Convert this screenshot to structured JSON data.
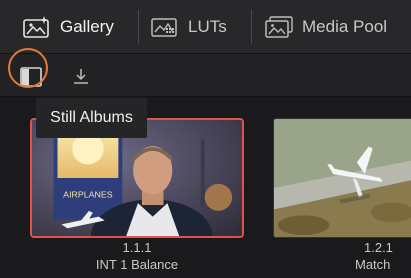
{
  "tabs": [
    {
      "label": "Gallery",
      "icon": "gallery-icon",
      "active": true
    },
    {
      "label": "LUTs",
      "icon": "luts-icon",
      "active": false
    },
    {
      "label": "Media Pool",
      "icon": "media-pool-icon",
      "active": false
    }
  ],
  "toolbar": {
    "still_albums_icon": "still-albums-icon",
    "import_icon": "import-icon",
    "tooltip": "Still Albums"
  },
  "stills": [
    {
      "number": "1.1.1",
      "name": "INT 1 Balance",
      "selected": true
    },
    {
      "number": "1.2.1",
      "name": "Match",
      "selected": false
    }
  ],
  "colors": {
    "highlight_ring": "#e47a39",
    "selected_border": "#e0524a"
  }
}
